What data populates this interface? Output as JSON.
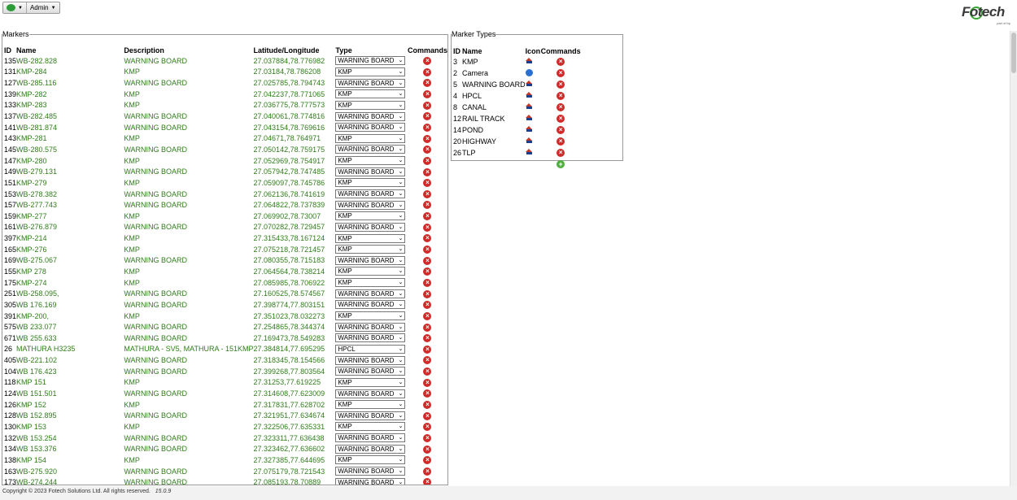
{
  "toolbar": {
    "admin_label": "Admin"
  },
  "logo": {
    "brand": "Fotech",
    "tagline": "part of bp"
  },
  "markers": {
    "legend": "Markers",
    "headers": {
      "id": "ID",
      "name": "Name",
      "description": "Description",
      "latlong": "Latitude/Longitude",
      "type": "Type",
      "commands": "Commands"
    },
    "rows": [
      {
        "id": "135",
        "name": "WB-282.828",
        "description": "WARNING BOARD",
        "latlong": "27.037884,78.776982",
        "type": "WARNING BOARD"
      },
      {
        "id": "131",
        "name": "KMP-284",
        "description": "KMP",
        "latlong": "27.03184,78.786208",
        "type": "KMP"
      },
      {
        "id": "127",
        "name": "WB-285.116",
        "description": "WARNING BOARD",
        "latlong": "27.025785,78.794743",
        "type": "WARNING BOARD"
      },
      {
        "id": "139",
        "name": "KMP-282",
        "description": "KMP",
        "latlong": "27.042237,78.771065",
        "type": "KMP"
      },
      {
        "id": "133",
        "name": "KMP-283",
        "description": "KMP",
        "latlong": "27.036775,78.777573",
        "type": "KMP"
      },
      {
        "id": "137",
        "name": "WB-282.485",
        "description": "WARNING BOARD",
        "latlong": "27.040061,78.774816",
        "type": "WARNING BOARD"
      },
      {
        "id": "141",
        "name": "WB-281.874",
        "description": "WARNING BOARD",
        "latlong": "27.043154,78.769616",
        "type": "WARNING BOARD"
      },
      {
        "id": "143",
        "name": "KMP-281",
        "description": "KMP",
        "latlong": "27.04671,78.764971",
        "type": "KMP"
      },
      {
        "id": "145",
        "name": "WB-280.575",
        "description": "WARNING BOARD",
        "latlong": "27.050142,78.759175",
        "type": "WARNING BOARD"
      },
      {
        "id": "147",
        "name": "KMP-280",
        "description": "KMP",
        "latlong": "27.052969,78.754917",
        "type": "KMP"
      },
      {
        "id": "149",
        "name": "WB-279.131",
        "description": "WARNING BOARD",
        "latlong": "27.057942,78.747485",
        "type": "WARNING BOARD"
      },
      {
        "id": "151",
        "name": "KMP-279",
        "description": "KMP",
        "latlong": "27.059097,78.745786",
        "type": "KMP"
      },
      {
        "id": "153",
        "name": "WB-278.382",
        "description": "WARNING BOARD",
        "latlong": "27.062136,78.741619",
        "type": "WARNING BOARD"
      },
      {
        "id": "157",
        "name": "WB-277.743",
        "description": "WARNING BOARD",
        "latlong": "27.064822,78.737839",
        "type": "WARNING BOARD"
      },
      {
        "id": "159",
        "name": "KMP-277",
        "description": "KMP",
        "latlong": "27.069902,78.73007",
        "type": "KMP"
      },
      {
        "id": "161",
        "name": "WB-276.879",
        "description": "WARNING BOARD",
        "latlong": "27.070282,78.729457",
        "type": "WARNING BOARD"
      },
      {
        "id": "397",
        "name": "KMP-214",
        "description": "KMP",
        "latlong": "27.315433,78.167124",
        "type": "KMP"
      },
      {
        "id": "165",
        "name": "KMP-276",
        "description": "KMP",
        "latlong": "27.075218,78.721457",
        "type": "KMP"
      },
      {
        "id": "169",
        "name": "WB-275.067",
        "description": "WARNING BOARD",
        "latlong": "27.080355,78.715183",
        "type": "WARNING BOARD"
      },
      {
        "id": "155",
        "name": "KMP 278",
        "description": "KMP",
        "latlong": "27.064564,78.738214",
        "type": "KMP"
      },
      {
        "id": "175",
        "name": "KMP-274",
        "description": "KMP",
        "latlong": "27.085985,78.706922",
        "type": "KMP"
      },
      {
        "id": "251",
        "name": "WB-258.095,",
        "description": "WARNING BOARD",
        "latlong": "27.160525,78.574567",
        "type": "WARNING BOARD"
      },
      {
        "id": "305",
        "name": "WB 176.169",
        "description": "WARNING BOARD",
        "latlong": "27.398774,77.803151",
        "type": "WARNING BOARD"
      },
      {
        "id": "391",
        "name": "KMP-200,",
        "description": "KMP",
        "latlong": "27.351023,78.032273",
        "type": "KMP"
      },
      {
        "id": "575",
        "name": "WB 233.077",
        "description": "WARNING BOARD",
        "latlong": "27.254865,78.344374",
        "type": "WARNING BOARD"
      },
      {
        "id": "671",
        "name": "WB 255.633",
        "description": "WARNING BOARD",
        "latlong": "27.169473,78.549283",
        "type": "WARNING BOARD"
      },
      {
        "id": "26",
        "name": "MATHURA H3235",
        "description": "MATHURA - SV5, MATHURA - 151KMP",
        "latlong": "27.384814,77.695295",
        "type": "HPCL"
      },
      {
        "id": "405",
        "name": "WB-221.102",
        "description": "WARNING BOARD",
        "latlong": "27.318345,78.154566",
        "type": "WARNING BOARD"
      },
      {
        "id": "104",
        "name": "WB 176.423",
        "description": "WARNING BOARD",
        "latlong": "27.399268,77.803564",
        "type": "WARNING BOARD"
      },
      {
        "id": "118",
        "name": "KMP 151",
        "description": "KMP",
        "latlong": "27.31253,77.619225",
        "type": "KMP"
      },
      {
        "id": "124",
        "name": "WB 151.501",
        "description": "WARNING BOARD",
        "latlong": "27.314608,77.623009",
        "type": "WARNING BOARD"
      },
      {
        "id": "126",
        "name": "KMP 152",
        "description": "KMP",
        "latlong": "27.317831,77.628702",
        "type": "KMP"
      },
      {
        "id": "128",
        "name": "WB 152.895",
        "description": "WARNING BOARD",
        "latlong": "27.321951,77.634674",
        "type": "WARNING BOARD"
      },
      {
        "id": "130",
        "name": "KMP 153",
        "description": "KMP",
        "latlong": "27.322506,77.635331",
        "type": "KMP"
      },
      {
        "id": "132",
        "name": "WB 153.254",
        "description": "WARNING BOARD",
        "latlong": "27.323311,77.636438",
        "type": "WARNING BOARD"
      },
      {
        "id": "134",
        "name": "WB 153.376",
        "description": "WARNING BOARD",
        "latlong": "27.323462,77.636602",
        "type": "WARNING BOARD"
      },
      {
        "id": "138",
        "name": "KMP 154",
        "description": "KMP",
        "latlong": "27.327385,77.644695",
        "type": "KMP"
      },
      {
        "id": "163",
        "name": "WB-275.920",
        "description": "WARNING BOARD",
        "latlong": "27.075179,78.721543",
        "type": "WARNING BOARD"
      },
      {
        "id": "173",
        "name": "WB-274.244",
        "description": "WARNING BOARD",
        "latlong": "27.085193,78.70889",
        "type": "WARNING BOARD"
      }
    ]
  },
  "marker_types": {
    "legend": "Marker Types",
    "headers": {
      "id": "ID",
      "name": "Name",
      "icon": "Icon",
      "commands": "Commands"
    },
    "rows": [
      {
        "id": "3",
        "name": "KMP",
        "icon": "house-marker-icon"
      },
      {
        "id": "2",
        "name": "Camera",
        "icon": "camera-marker-icon"
      },
      {
        "id": "5",
        "name": "WARNING BOARD",
        "icon": "house-marker-icon"
      },
      {
        "id": "4",
        "name": "HPCL",
        "icon": "house-marker-icon"
      },
      {
        "id": "8",
        "name": "CANAL",
        "icon": "house-marker-icon"
      },
      {
        "id": "12",
        "name": "RAIL TRACK",
        "icon": "house-marker-icon"
      },
      {
        "id": "14",
        "name": "POND",
        "icon": "house-marker-icon"
      },
      {
        "id": "20",
        "name": "HIGHWAY",
        "icon": "house-marker-icon"
      },
      {
        "id": "26",
        "name": "TLP",
        "icon": "house-marker-icon"
      }
    ]
  },
  "footer": {
    "copyright": "Copyright © 2023 Fotech Solutions Ltd. All rights reserved.",
    "version": "15.0.9"
  },
  "colors": {
    "green_text": "#2e7d18",
    "delete": "#d22a2a",
    "add": "#4caf3a"
  }
}
